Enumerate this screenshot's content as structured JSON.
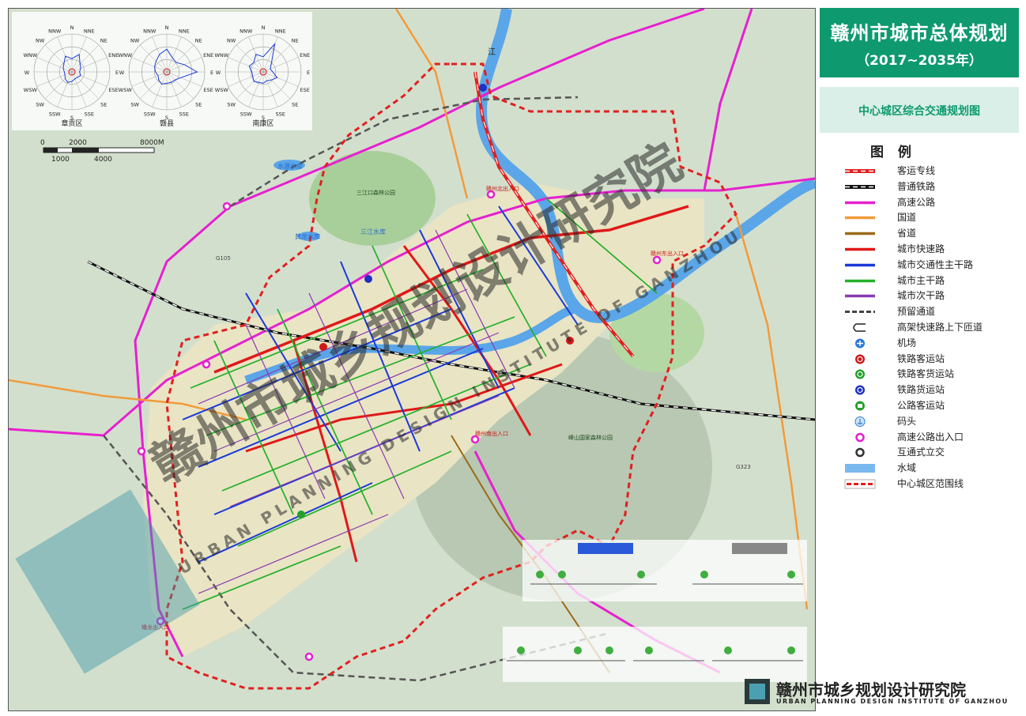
{
  "header": {
    "title": "赣州市城市总体规划",
    "years": "（2017~2035年）",
    "subtitle": "中心城区综合交通规划图"
  },
  "legend": {
    "title": "图 例",
    "items": [
      {
        "label": "客运专线",
        "symbol": "passenger-rail",
        "color": "#e02020"
      },
      {
        "label": "普通铁路",
        "symbol": "rail",
        "color": "#111111"
      },
      {
        "label": "高速公路",
        "symbol": "line",
        "color": "#e620d0"
      },
      {
        "label": "国道",
        "symbol": "line",
        "color": "#f29a3a"
      },
      {
        "label": "省道",
        "symbol": "line",
        "color": "#9a6a1a"
      },
      {
        "label": "城市快速路",
        "symbol": "line",
        "color": "#e01818"
      },
      {
        "label": "城市交通性主干路",
        "symbol": "line",
        "color": "#1a3ad8"
      },
      {
        "label": "城市主干路",
        "symbol": "line",
        "color": "#22b02a"
      },
      {
        "label": "城市次干路",
        "symbol": "line",
        "color": "#8a3ab0"
      },
      {
        "label": "预留通道",
        "symbol": "dashed",
        "color": "#444444"
      },
      {
        "label": "高架快速路上下匝道",
        "symbol": "ramp",
        "color": "#222222"
      },
      {
        "label": "机场",
        "symbol": "airport",
        "color": "#2a7ad8"
      },
      {
        "label": "铁路客运站",
        "symbol": "rail-passenger-station",
        "color": "#d01818"
      },
      {
        "label": "铁路客货运站",
        "symbol": "rail-mixed-station",
        "color": "#22a02a"
      },
      {
        "label": "铁路货运站",
        "symbol": "rail-freight-station",
        "color": "#2030c0"
      },
      {
        "label": "公路客运站",
        "symbol": "bus-station",
        "color": "#22a02a"
      },
      {
        "label": "码头",
        "symbol": "port",
        "color": "#2a7ad8"
      },
      {
        "label": "高速公路出入口",
        "symbol": "ring",
        "color": "#e620d0"
      },
      {
        "label": "互通式立交",
        "symbol": "ring",
        "color": "#333333"
      },
      {
        "label": "水域",
        "symbol": "water",
        "color": "#7ab8f0"
      },
      {
        "label": "中心城区范围线",
        "symbol": "boundary",
        "color": "#e02020"
      }
    ]
  },
  "wind_roses": [
    {
      "caption": "章贡区",
      "labels": [
        "NNW",
        "N",
        "NNE",
        "NE",
        "ENE",
        "E",
        "ESE",
        "SE",
        "SSE",
        "S",
        "SSW",
        "SW",
        "WSW",
        "W",
        "WNW",
        "NW"
      ]
    },
    {
      "caption": "赣县",
      "labels": [
        "NNW",
        "N",
        "NNE",
        "NE",
        "ENE",
        "E",
        "ESE",
        "SE",
        "SSE",
        "S",
        "SSW",
        "SW",
        "WSW",
        "W",
        "WNW",
        "NW"
      ]
    },
    {
      "caption": "南康区",
      "labels": [
        "NNW",
        "N",
        "NNE",
        "NE",
        "ENE",
        "E",
        "ESE",
        "SE",
        "SSE",
        "S",
        "SSW",
        "SW",
        "WSW",
        "W",
        "WNW",
        "NW"
      ]
    }
  ],
  "scale_bar": {
    "ticks_top": [
      "0",
      "2000",
      "8000M"
    ],
    "ticks_bottom": [
      "1000",
      "4000"
    ]
  },
  "map_labels": {
    "reservoir_1": "水源水库",
    "reservoir_2": "黄龙水库",
    "reservoir_3": "三江水库",
    "river": "江",
    "park_1": "三江口森林公园",
    "park_2": "峰山国家森林公园",
    "road_1": "G105",
    "road_2": "G323",
    "exit_1": "赣州北出入口",
    "exit_2": "赣州东出入口",
    "exit_3": "赣州南出入口",
    "exit_4": "蟠龙出入口"
  },
  "watermarks": {
    "big_cn": "赣州市城乡规划设计研究院",
    "big_en": "URBAN PLANNING DESIGN INSTITUTE OF GANZHOU",
    "corner_cn": "赣州市城乡规划设计研究院",
    "corner_en": "URBAN PLANNING DESIGN INSTITUTE OF GANZHOU"
  },
  "institute": {
    "name_cn": "赣州市城乡规划设计研究院",
    "name_en": "URBAN PLANNING DESIGN INSTITUTE OF GANZHOU"
  }
}
